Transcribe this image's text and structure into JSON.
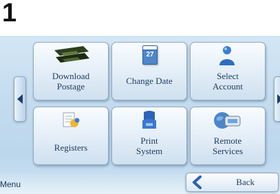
{
  "step_number": "1",
  "tiles": [
    {
      "label_line1": "Download",
      "label_line2": "Postage",
      "icon": "download-postage-icon"
    },
    {
      "label_line1": "Change Date",
      "label_line2": "",
      "icon": "calendar-icon",
      "calendar_day": "27"
    },
    {
      "label_line1": "Select",
      "label_line2": "Account",
      "icon": "account-person-icon"
    },
    {
      "label_line1": "Registers",
      "label_line2": "",
      "icon": "registers-icon"
    },
    {
      "label_line1": "Print",
      "label_line2": "System",
      "icon": "print-system-icon"
    },
    {
      "label_line1": "Remote",
      "label_line2": "Services",
      "icon": "remote-services-icon"
    }
  ],
  "footer": {
    "menu_label": "Menu",
    "back_label": "Back"
  },
  "colors": {
    "label_text": "#1d3b5e",
    "screen_bg": "#c3dbee",
    "tile_border": "#8ea8c0"
  }
}
